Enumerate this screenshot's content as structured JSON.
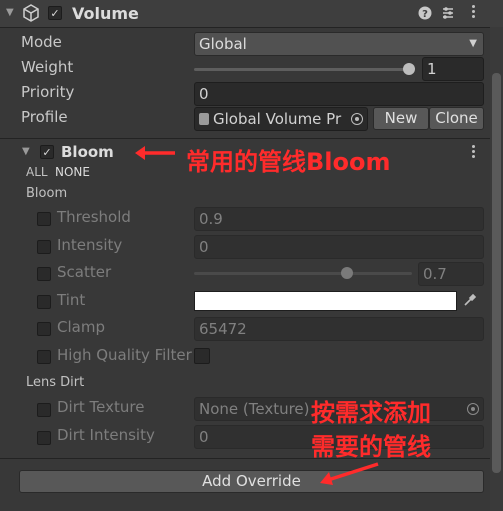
{
  "component": {
    "title": "Volume"
  },
  "props": {
    "mode_label": "Mode",
    "mode_value": "Global",
    "weight_label": "Weight",
    "weight_value": "1",
    "weight_level": 1.0,
    "priority_label": "Priority",
    "priority_value": "0",
    "profile_label": "Profile",
    "profile_value": "Global Volume Pr",
    "new_label": "New",
    "clone_label": "Clone"
  },
  "bloom": {
    "title": "Bloom",
    "all_label": "ALL",
    "none_label": "NONE",
    "section_label": "Bloom",
    "threshold_label": "Threshold",
    "threshold_value": "0.9",
    "intensity_label": "Intensity",
    "intensity_value": "0",
    "scatter_label": "Scatter",
    "scatter_value": "0.7",
    "scatter_level": 0.7,
    "tint_label": "Tint",
    "tint_color": "#ffffff",
    "clamp_label": "Clamp",
    "clamp_value": "65472",
    "hq_label": "High Quality Filteri",
    "lens_dirt_label": "Lens Dirt",
    "dirt_texture_label": "Dirt Texture",
    "dirt_texture_value": "None (Texture)",
    "dirt_intensity_label": "Dirt Intensity",
    "dirt_intensity_value": "0"
  },
  "add_override_label": "Add Override",
  "annotations": {
    "bloom_note": "常用的管线Bloom",
    "add_note_line1": "按需求添加",
    "add_note_line2": "需要的管线"
  },
  "colors": {
    "annotation": "#ff2b2b",
    "tint": "#ffffff"
  }
}
